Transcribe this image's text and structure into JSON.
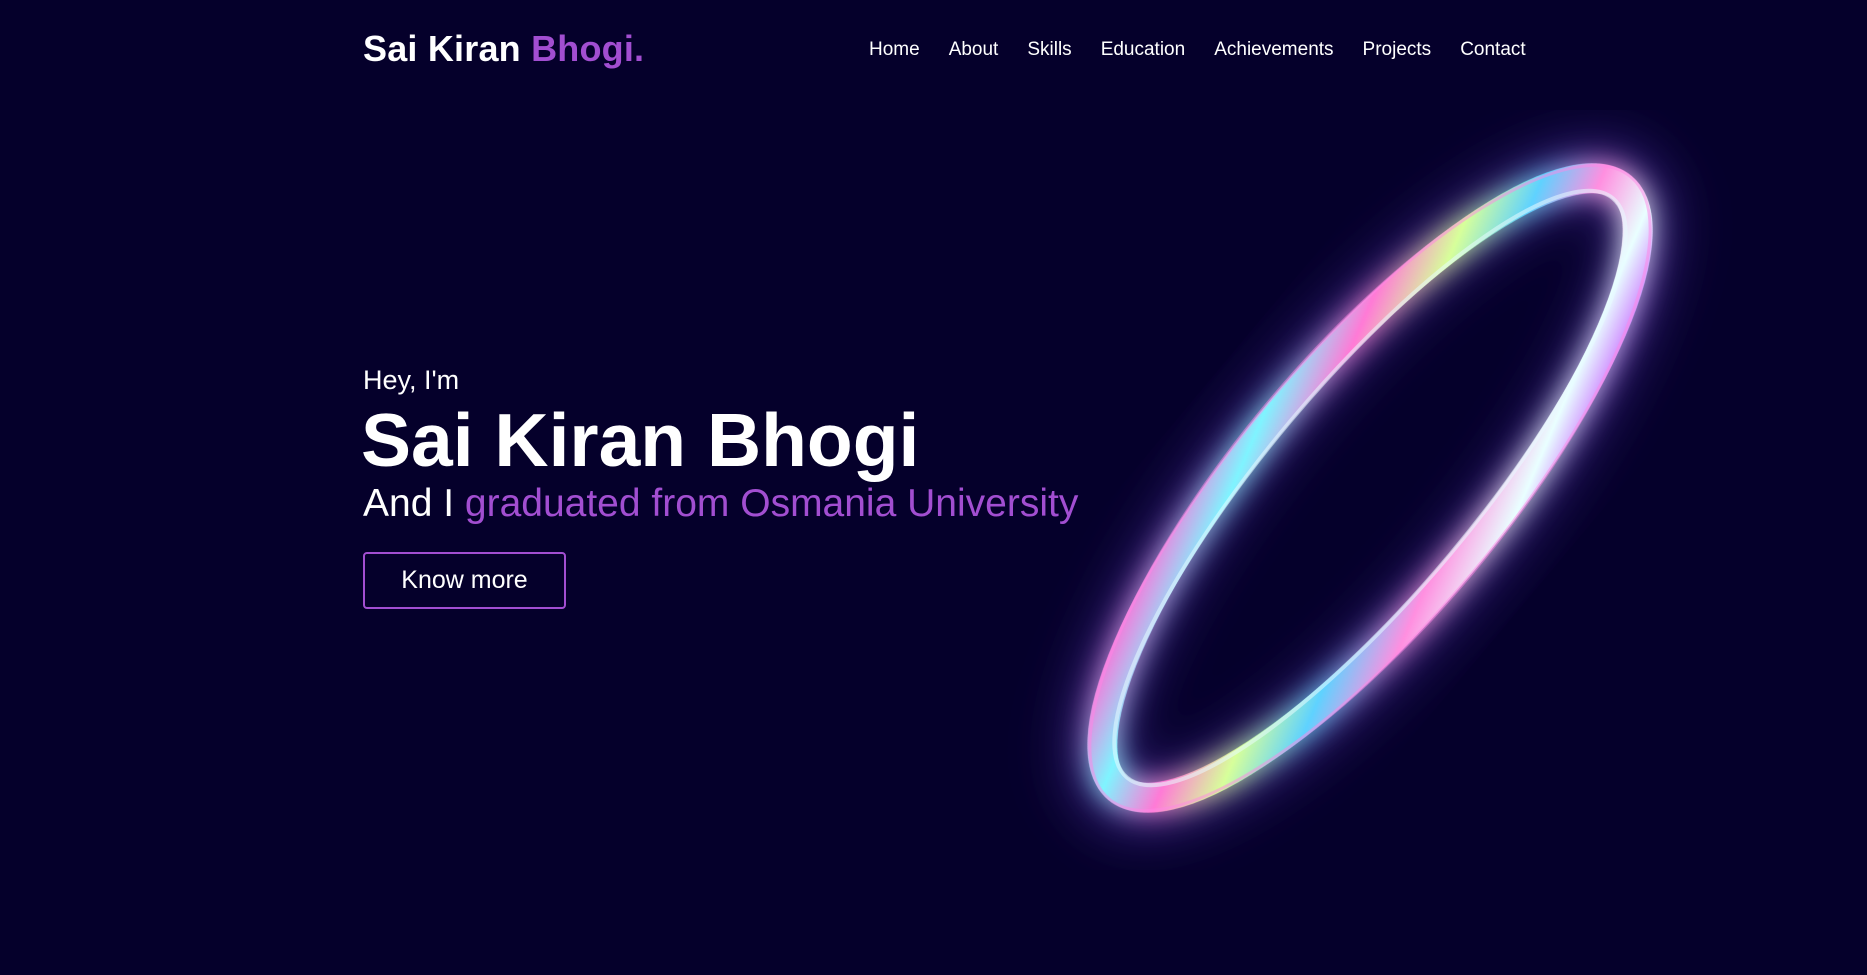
{
  "header": {
    "logo_first": "Sai Kiran ",
    "logo_accent": "Bhogi.",
    "nav": [
      {
        "label": "Home"
      },
      {
        "label": "About"
      },
      {
        "label": "Skills"
      },
      {
        "label": "Education"
      },
      {
        "label": "Achievements"
      },
      {
        "label": "Projects"
      },
      {
        "label": "Contact"
      }
    ]
  },
  "hero": {
    "greeting": "Hey, I'm",
    "name": "Sai Kiran Bhogi",
    "tagline_prefix": "And I ",
    "tagline_accent": "graduated from Osmania University",
    "cta_label": "Know more"
  },
  "colors": {
    "background": "#05002b",
    "accent": "#a24ed1",
    "text": "#ffffff"
  },
  "icons": {
    "hero_art": "iridescent-ring-icon"
  }
}
